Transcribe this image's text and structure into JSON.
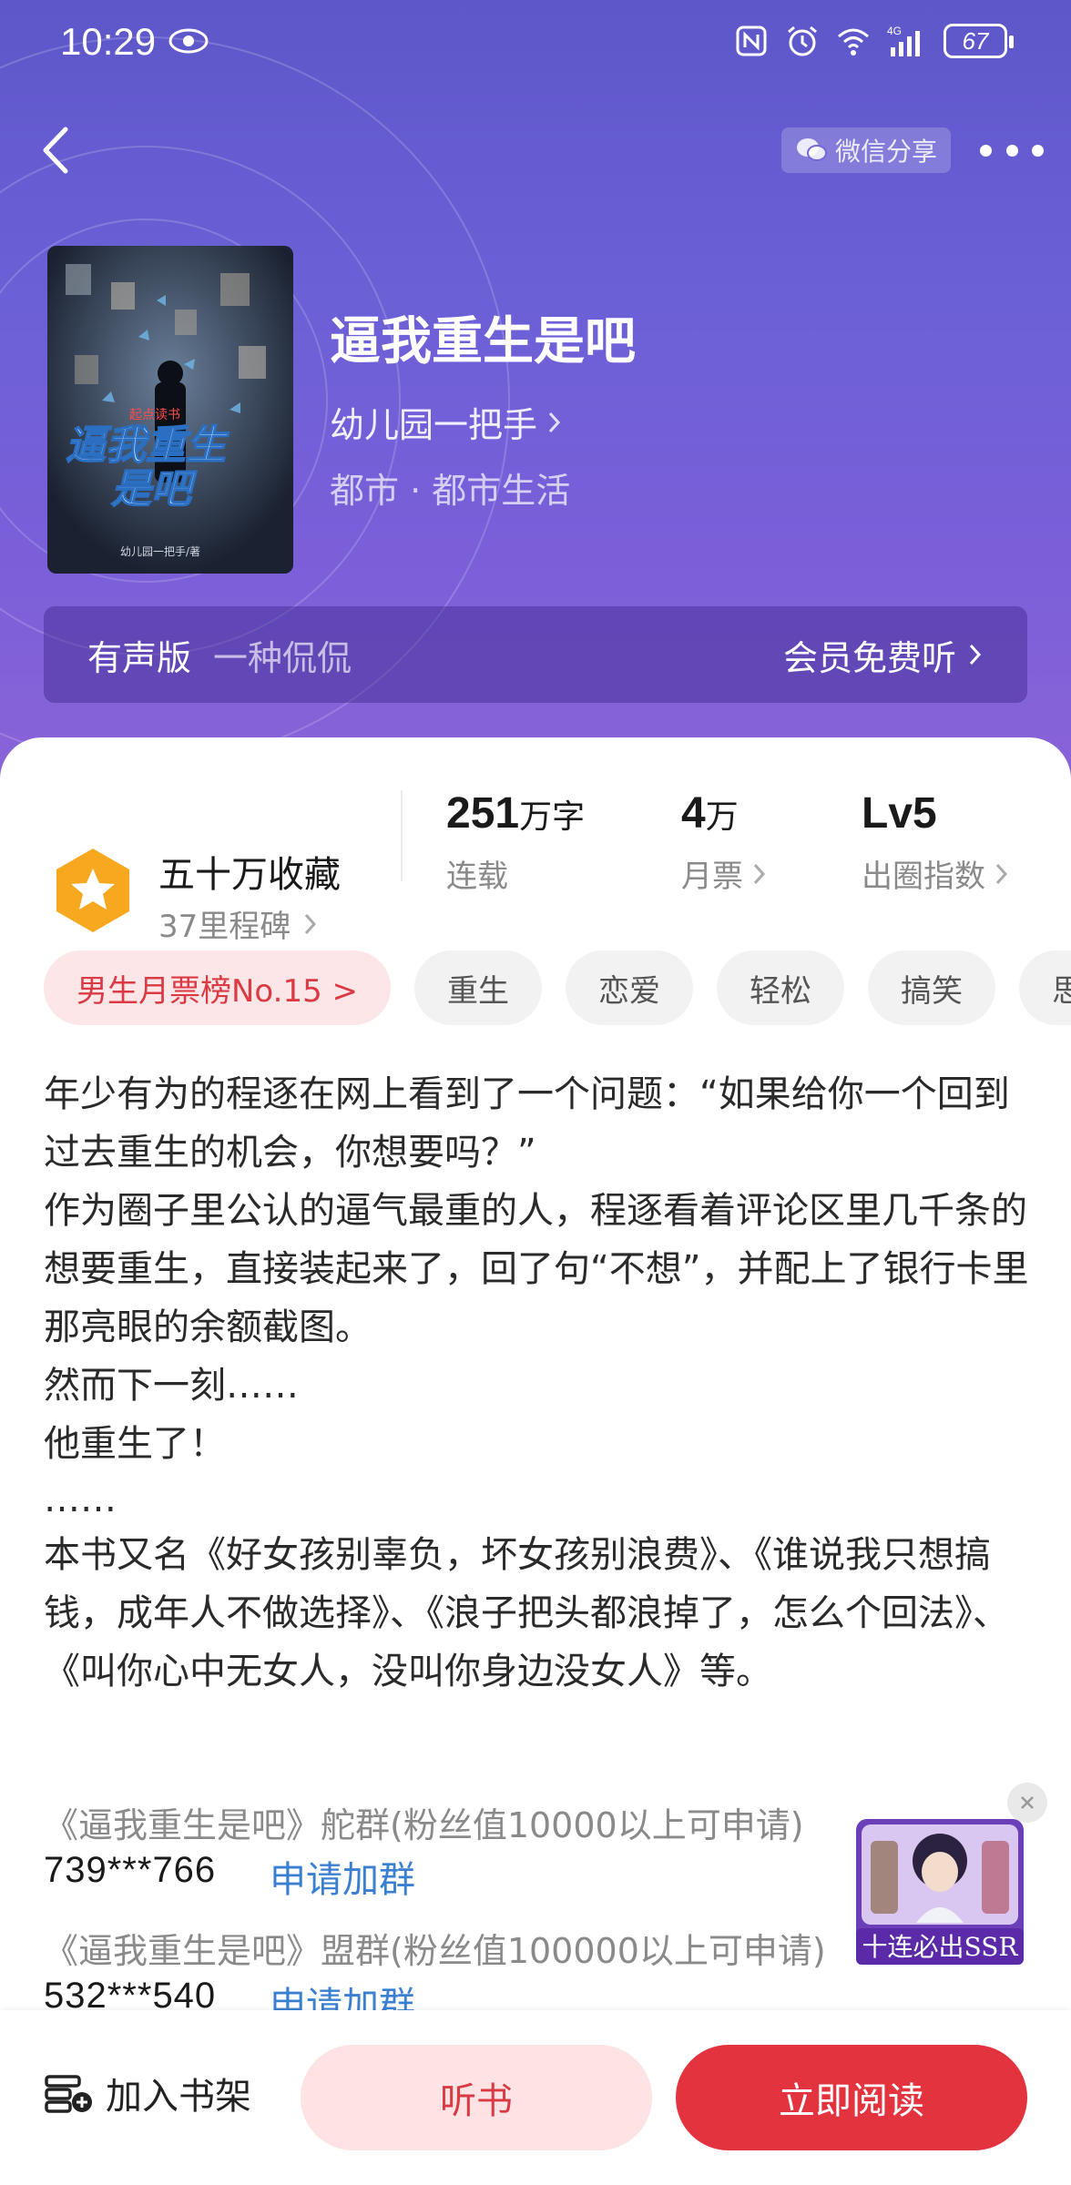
{
  "status_bar": {
    "time": "10:29",
    "battery": "67",
    "network": "4G"
  },
  "header": {
    "share_label": "微信分享"
  },
  "book": {
    "title": "逼我重生是吧",
    "author": "幼儿园一把手",
    "genre": "都市 · 都市生活",
    "cover_text": {
      "publisher": "起点读书",
      "title_line1": "逼我重生",
      "title_line2": "是吧",
      "author": "幼儿园一把手/著"
    }
  },
  "audio": {
    "label": "有声版",
    "narrator": "一种侃侃",
    "vip_label": "会员免费听"
  },
  "stats": {
    "favorites_title": "五十万收藏",
    "favorites_sub": "37里程碑",
    "words_num": "251",
    "words_unit": "万字",
    "words_label": "连载",
    "tickets_num": "4",
    "tickets_unit": "万",
    "tickets_label": "月票",
    "level": "Lv5",
    "level_label": "出圈指数"
  },
  "tags": {
    "rank": "男生月票榜No.15 >",
    "items": [
      "重生",
      "恋爱",
      "轻松",
      "搞笑",
      "思"
    ]
  },
  "description": {
    "p1": "年少有为的程逐在网上看到了一个问题：“如果给你一个回到过去重生的机会，你想要吗？”",
    "p2": "作为圈子里公认的逼气最重的人，程逐看着评论区里几千条的想要重生，直接装起来了，回了句“不想”，并配上了银行卡里那亮眼的余额截图。",
    "p3": "然而下一刻……",
    "p4": "他重生了！",
    "p5": "……",
    "p6": "本书又名《好女孩别辜负，坏女孩别浪费》、《谁说我只想搞钱，成年人不做选择》、《浪子把头都浪掉了，怎么个回法》、《叫你心中无女人，没叫你身边没女人》等。"
  },
  "groups": [
    {
      "name": "《逼我重生是吧》舵群(粉丝值10000以上可申请)",
      "id": "739***766",
      "join": "申请加群"
    },
    {
      "name": "《逼我重生是吧》盟群(粉丝值100000以上可申请)",
      "id": "532***540",
      "join": "申请加群"
    }
  ],
  "float_ad": {
    "text": "十连必出SSR"
  },
  "bottom_bar": {
    "shelf_label": "加入书架",
    "listen_label": "听书",
    "read_label": "立即阅读"
  }
}
